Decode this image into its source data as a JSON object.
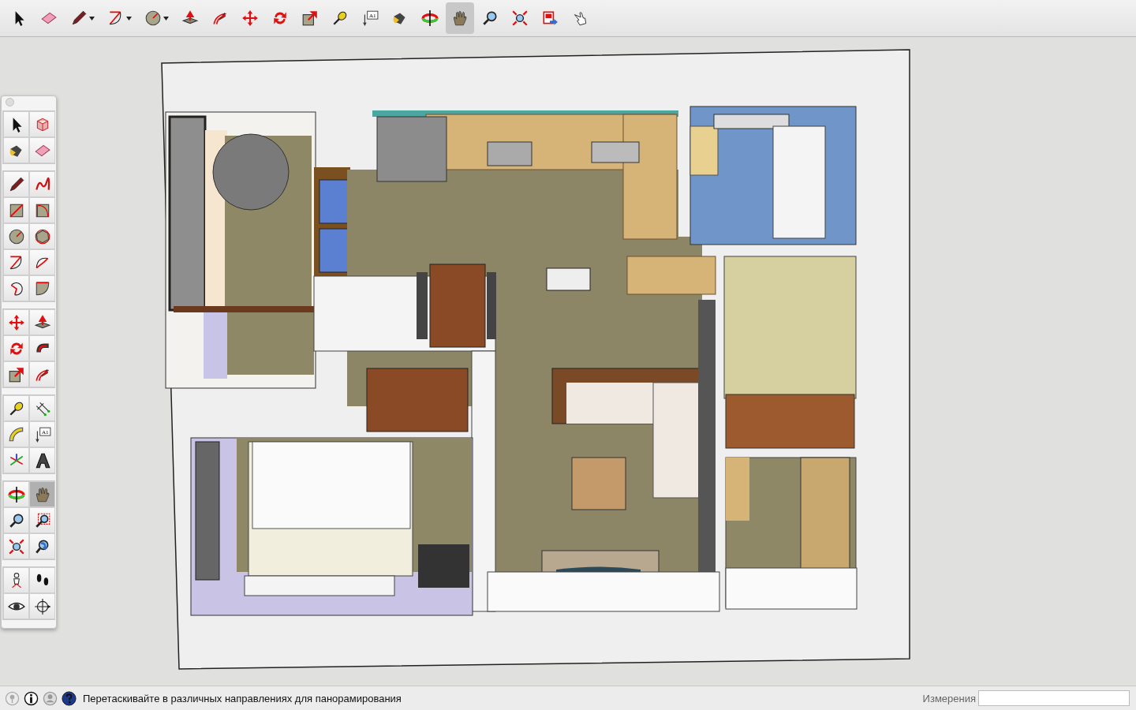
{
  "toolbar": {
    "tools": [
      {
        "kind": "select",
        "selected": false,
        "dropdown": false
      },
      {
        "kind": "eraser",
        "selected": false,
        "dropdown": false
      },
      {
        "kind": "pencil",
        "selected": false,
        "dropdown": true
      },
      {
        "kind": "arc",
        "selected": false,
        "dropdown": true
      },
      {
        "kind": "circle",
        "selected": false,
        "dropdown": true
      },
      {
        "kind": "pushpull",
        "selected": false,
        "dropdown": false
      },
      {
        "kind": "offset",
        "selected": false,
        "dropdown": false
      },
      {
        "kind": "move",
        "selected": false,
        "dropdown": false
      },
      {
        "kind": "rotate",
        "selected": false,
        "dropdown": false
      },
      {
        "kind": "scale",
        "selected": false,
        "dropdown": false
      },
      {
        "kind": "tape",
        "selected": false,
        "dropdown": false
      },
      {
        "kind": "text",
        "label": "A1",
        "selected": false,
        "dropdown": false
      },
      {
        "kind": "paint",
        "selected": false,
        "dropdown": false
      },
      {
        "kind": "orbit",
        "selected": false,
        "dropdown": false
      },
      {
        "kind": "pan",
        "selected": true,
        "dropdown": false
      },
      {
        "kind": "zoom",
        "selected": false,
        "dropdown": false
      },
      {
        "kind": "zoom-extents",
        "selected": false,
        "dropdown": false
      },
      {
        "kind": "export",
        "selected": false,
        "dropdown": false
      },
      {
        "kind": "pointer-hand",
        "selected": false,
        "dropdown": false
      }
    ]
  },
  "palette": {
    "groups": [
      {
        "tools": [
          {
            "kind": "select",
            "selected": false
          },
          {
            "kind": "component",
            "selected": false
          },
          {
            "kind": "paint",
            "selected": false
          },
          {
            "kind": "eraser",
            "selected": false
          }
        ]
      },
      {
        "tools": [
          {
            "kind": "pencil",
            "selected": false
          },
          {
            "kind": "freehand",
            "selected": false
          },
          {
            "kind": "rectangle",
            "selected": false
          },
          {
            "kind": "rotated-rect",
            "selected": false
          },
          {
            "kind": "circle",
            "selected": false
          },
          {
            "kind": "polygon",
            "selected": false
          },
          {
            "kind": "arc",
            "selected": false
          },
          {
            "kind": "arc2",
            "selected": false
          },
          {
            "kind": "arc3",
            "selected": false
          },
          {
            "kind": "pie",
            "selected": false
          }
        ]
      },
      {
        "tools": [
          {
            "kind": "move",
            "selected": false
          },
          {
            "kind": "pushpull",
            "selected": false
          },
          {
            "kind": "rotate",
            "selected": false
          },
          {
            "kind": "followme",
            "selected": false
          },
          {
            "kind": "scale",
            "selected": false
          },
          {
            "kind": "offset",
            "selected": false
          }
        ]
      },
      {
        "tools": [
          {
            "kind": "tape",
            "selected": false
          },
          {
            "kind": "dimension",
            "selected": false
          },
          {
            "kind": "protractor",
            "selected": false
          },
          {
            "kind": "text",
            "label": "A1",
            "selected": false
          },
          {
            "kind": "axes",
            "selected": false
          },
          {
            "kind": "solidtext",
            "selected": false
          }
        ]
      },
      {
        "tools": [
          {
            "kind": "orbit",
            "selected": false
          },
          {
            "kind": "pan",
            "selected": true
          },
          {
            "kind": "zoom",
            "selected": false
          },
          {
            "kind": "zoom-window",
            "selected": false
          },
          {
            "kind": "zoom-extents",
            "selected": false
          },
          {
            "kind": "previous",
            "selected": false
          }
        ]
      },
      {
        "tools": [
          {
            "kind": "position",
            "selected": false
          },
          {
            "kind": "walk",
            "selected": false
          },
          {
            "kind": "look",
            "selected": false
          },
          {
            "kind": "section",
            "selected": false
          }
        ]
      }
    ]
  },
  "status_bar": {
    "icons": [
      {
        "kind": "pin"
      },
      {
        "kind": "info"
      },
      {
        "kind": "user"
      },
      {
        "kind": "help"
      }
    ],
    "message": "Перетаскивайте в различных направлениях для панорамирования",
    "measurements_label": "Измерения"
  }
}
